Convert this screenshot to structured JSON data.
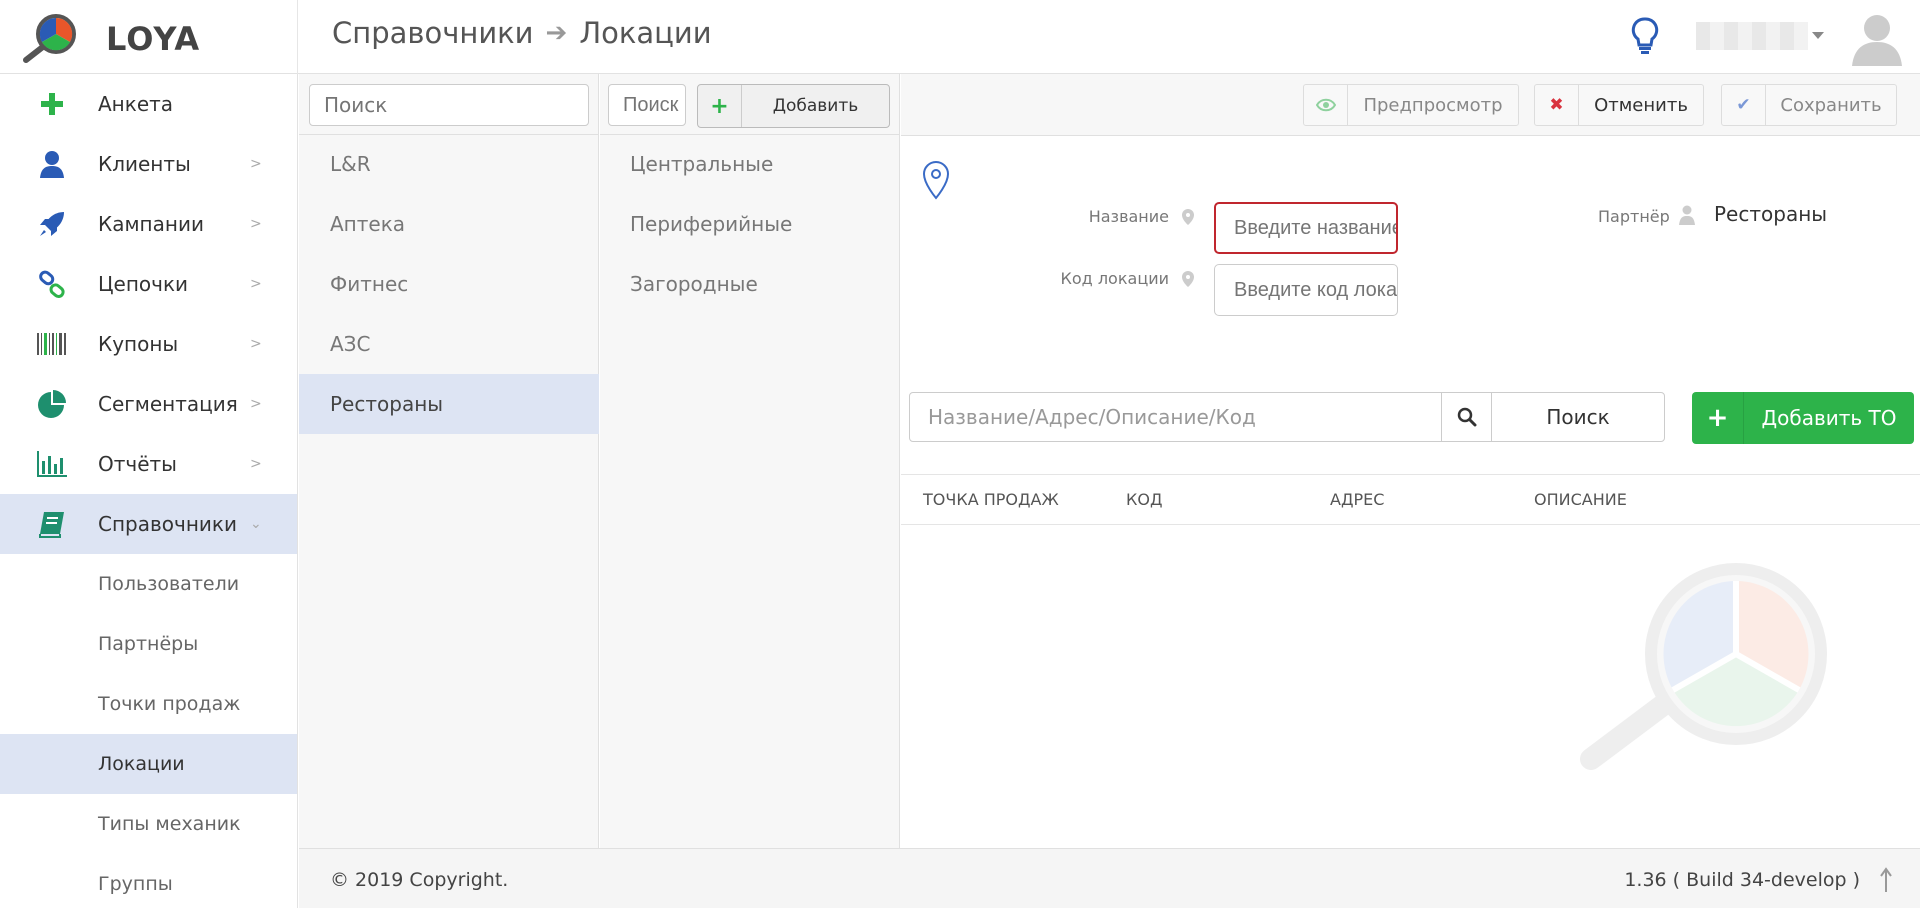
{
  "app": {
    "logo_text": "LOYA"
  },
  "breadcrumb": {
    "parent": "Справочники",
    "current": "Локации"
  },
  "sidebar": {
    "items": [
      {
        "label": "Анкета",
        "icon": "plus-icon"
      },
      {
        "label": "Клиенты",
        "icon": "user-icon"
      },
      {
        "label": "Кампании",
        "icon": "rocket-icon"
      },
      {
        "label": "Цепочки",
        "icon": "chain-icon"
      },
      {
        "label": "Купоны",
        "icon": "barcode-icon"
      },
      {
        "label": "Сегментация",
        "icon": "pie-icon"
      },
      {
        "label": "Отчёты",
        "icon": "bar-chart-icon"
      },
      {
        "label": "Справочники",
        "icon": "book-icon"
      }
    ],
    "subitems": [
      "Пользователи",
      "Партнёры",
      "Точки продаж",
      "Локации",
      "Типы механик",
      "Группы"
    ]
  },
  "col1": {
    "search_placeholder": "Поиск",
    "items": [
      "L&R",
      "Аптека",
      "Фитнес",
      "АЗС",
      "Рестораны"
    ]
  },
  "col2": {
    "search_placeholder": "Поиск",
    "add_label": "Добавить",
    "items": [
      "Центральные",
      "Периферийные",
      "Загородные"
    ]
  },
  "toolbar": {
    "preview": "Предпросмотр",
    "cancel": "Отменить",
    "save": "Сохранить"
  },
  "form": {
    "name_label": "Название",
    "name_placeholder": "Введите название",
    "code_label": "Код локации",
    "code_placeholder": "Введите код локации",
    "partner_label": "Партнёр",
    "partner_value": "Рестораны"
  },
  "search": {
    "placeholder": "Название/Адрес/Описание/Код",
    "button": "Поиск",
    "add_button": "Добавить ТО"
  },
  "table": {
    "columns": [
      "Точка продаж",
      "Код",
      "Адрес",
      "Описание"
    ]
  },
  "footer": {
    "copyright": "© 2019 Copyright.",
    "version": "1.36 ( Build 34-develop )"
  },
  "colors": {
    "accent": "#2db34a",
    "active_bg": "#dde4f3",
    "error": "#c0262e",
    "icon_blue": "#2a5bb5"
  }
}
